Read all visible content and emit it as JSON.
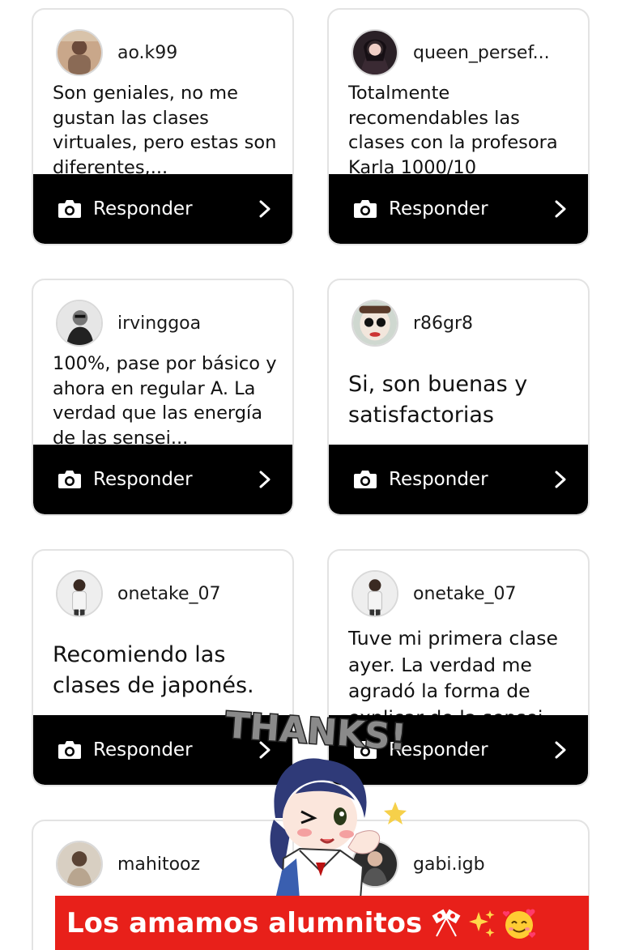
{
  "reply_label": "Responder",
  "cards": [
    {
      "username": "ao.k99",
      "comment": "Son geniales, no me gustan las clases virtuales, pero estas son diferentes,..."
    },
    {
      "username": "queen_persef...",
      "comment": "Totalmente recomendables las clases con la profesora Karla 1000/10"
    },
    {
      "username": "irvinggoa",
      "comment": "100%, pase por básico y ahora en regular A. La verdad que las energía de las sensei..."
    },
    {
      "username": "r86gr8",
      "comment": "Si, son buenas y satisfactorias"
    },
    {
      "username": "onetake_07",
      "comment": "Recomiendo las clases de japonés."
    },
    {
      "username": "onetake_07",
      "comment": "Tuve mi primera clase ayer. La verdad me agradó la forma de explicar de la sensei"
    },
    {
      "username": "mahitooz",
      "comment": ""
    },
    {
      "username": "gabi.igb",
      "comment": ""
    }
  ],
  "sticker_text": "THANKS!",
  "caption": "Los amamos alumnitos",
  "colors": {
    "reply_bar": "#000000",
    "banner": "#e8201a"
  }
}
